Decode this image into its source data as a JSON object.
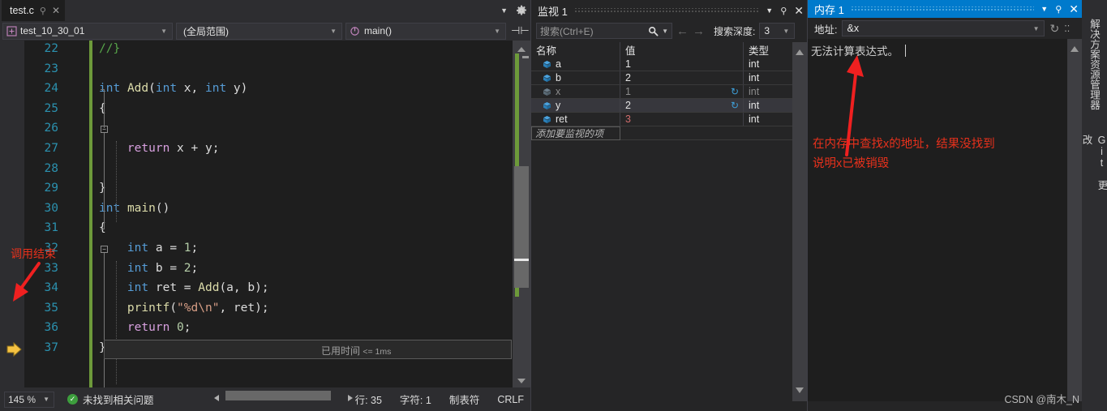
{
  "editor": {
    "tab": {
      "title": "test.c",
      "pin_icon": "pin-icon",
      "close_icon": "close-icon"
    },
    "navbar": {
      "project": "test_10_30_01",
      "scope": "(全局范围)",
      "function": "main()"
    },
    "lines": [
      {
        "n": "22",
        "tokens": [
          {
            "t": "//}",
            "c": "cmt"
          }
        ]
      },
      {
        "n": "23",
        "tokens": []
      },
      {
        "n": "24",
        "tokens": [
          {
            "t": "int",
            "c": "kw"
          },
          {
            "t": " ",
            "c": "pl"
          },
          {
            "t": "Add",
            "c": "fn"
          },
          {
            "t": "(",
            "c": "pl"
          },
          {
            "t": "int",
            "c": "kw"
          },
          {
            "t": " x, ",
            "c": "pl"
          },
          {
            "t": "int",
            "c": "kw"
          },
          {
            "t": " y)",
            "c": "pl"
          }
        ]
      },
      {
        "n": "25",
        "tokens": [
          {
            "t": "{",
            "c": "pl"
          }
        ]
      },
      {
        "n": "26",
        "tokens": []
      },
      {
        "n": "27",
        "tokens": [
          {
            "t": "    ",
            "c": "pl"
          },
          {
            "t": "return",
            "c": "ctl"
          },
          {
            "t": " x + y;",
            "c": "pl"
          }
        ]
      },
      {
        "n": "28",
        "tokens": []
      },
      {
        "n": "29",
        "tokens": [
          {
            "t": "}",
            "c": "pl"
          }
        ]
      },
      {
        "n": "30",
        "tokens": [
          {
            "t": "int",
            "c": "kw"
          },
          {
            "t": " ",
            "c": "pl"
          },
          {
            "t": "main",
            "c": "fn"
          },
          {
            "t": "()",
            "c": "pl"
          }
        ]
      },
      {
        "n": "31",
        "tokens": [
          {
            "t": "{",
            "c": "pl"
          }
        ]
      },
      {
        "n": "32",
        "tokens": [
          {
            "t": "    ",
            "c": "pl"
          },
          {
            "t": "int",
            "c": "kw"
          },
          {
            "t": " a = ",
            "c": "pl"
          },
          {
            "t": "1",
            "c": "num"
          },
          {
            "t": ";",
            "c": "pl"
          }
        ]
      },
      {
        "n": "33",
        "tokens": [
          {
            "t": "    ",
            "c": "pl"
          },
          {
            "t": "int",
            "c": "kw"
          },
          {
            "t": " b = ",
            "c": "pl"
          },
          {
            "t": "2",
            "c": "num"
          },
          {
            "t": ";",
            "c": "pl"
          }
        ]
      },
      {
        "n": "34",
        "tokens": [
          {
            "t": "    ",
            "c": "pl"
          },
          {
            "t": "int",
            "c": "kw"
          },
          {
            "t": " ret = ",
            "c": "pl"
          },
          {
            "t": "Add",
            "c": "fn"
          },
          {
            "t": "(a, b);",
            "c": "pl"
          }
        ]
      },
      {
        "n": "35",
        "tokens": [
          {
            "t": "    ",
            "c": "pl"
          },
          {
            "t": "printf",
            "c": "fn"
          },
          {
            "t": "(",
            "c": "pl"
          },
          {
            "t": "\"%d\\n\"",
            "c": "str"
          },
          {
            "t": ", ret);",
            "c": "pl"
          }
        ]
      },
      {
        "n": "36",
        "tokens": [
          {
            "t": "    ",
            "c": "pl"
          },
          {
            "t": "return",
            "c": "ctl"
          },
          {
            "t": " ",
            "c": "pl"
          },
          {
            "t": "0",
            "c": "num"
          },
          {
            "t": ";",
            "c": "pl"
          }
        ]
      },
      {
        "n": "37",
        "tokens": [
          {
            "t": "}",
            "c": "pl"
          }
        ]
      }
    ],
    "elapsed_label": "已用时间",
    "elapsed_value": "<= 1ms",
    "annotation": "调用结束"
  },
  "statusbar": {
    "zoom": "145 %",
    "problems": "未找到相关问题",
    "line": "行: 35",
    "col": "字符: 1",
    "tabs": "制表符",
    "eol": "CRLF"
  },
  "watch": {
    "title": "监视 1",
    "search_placeholder": "搜索(Ctrl+E)",
    "depth_label": "搜索深度:",
    "depth_value": "3",
    "columns": [
      "名称",
      "值",
      "类型"
    ],
    "rows": [
      {
        "name": "a",
        "value": "1",
        "type": "int",
        "dim": false,
        "selected": false,
        "refresh": false,
        "value_red": false
      },
      {
        "name": "b",
        "value": "2",
        "type": "int",
        "dim": false,
        "selected": false,
        "refresh": false,
        "value_red": false
      },
      {
        "name": "x",
        "value": "1",
        "type": "int",
        "dim": true,
        "selected": false,
        "refresh": true,
        "value_red": false
      },
      {
        "name": "y",
        "value": "2",
        "type": "int",
        "dim": false,
        "selected": true,
        "refresh": true,
        "value_red": false
      },
      {
        "name": "ret",
        "value": "3",
        "type": "int",
        "dim": false,
        "selected": false,
        "refresh": false,
        "value_red": true
      }
    ],
    "add_row_placeholder": "添加要监视的项"
  },
  "memory": {
    "title": "内存 1",
    "address_label": "地址:",
    "address_value": "&x",
    "message": "无法计算表达式。",
    "annotation_line1": "在内存中查找x的地址，结果没找到",
    "annotation_line2": "说明x已被销毁"
  },
  "right_tabs": {
    "solution_explorer": "解决方案资源管理器",
    "git_changes": "Git 更改"
  },
  "watermark": "CSDN @南木_N",
  "colors": {
    "accent_blue": "#007acc",
    "annotation_red": "#e8311c",
    "changebar_green": "#6d9a3a",
    "keyword_blue": "#569cd6",
    "function_yellow": "#dcdcaa",
    "string_orange": "#d69d85",
    "comment_green": "#57a64a",
    "linenum_teal": "#2b91af"
  }
}
